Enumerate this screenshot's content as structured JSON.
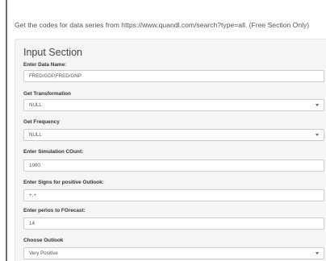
{
  "intro": {
    "text": "Get the codes for data series from https://www.quandl.com/search?type=all. (Free Section Only)"
  },
  "panel": {
    "title": "Input Section",
    "fields": [
      {
        "label": "Enter Data Name:",
        "type": "text",
        "value": "FRED/GDP,FRED/GNP"
      },
      {
        "label": "Get Transformation",
        "type": "select",
        "value": "NULL"
      },
      {
        "label": "Get Frequency",
        "type": "select",
        "value": "NULL"
      },
      {
        "label": "Enter Simulation COunt:",
        "type": "text",
        "value": "1000"
      },
      {
        "label": "Enter Signs for positive Outlook:",
        "type": "text",
        "value": "+,+"
      },
      {
        "label": "Enter perios to FOrecast:",
        "type": "text",
        "value": "14"
      },
      {
        "label": "Choose Outlook",
        "type": "select",
        "value": "Very Positive"
      }
    ]
  },
  "icons": {
    "dropdown": "chevron-down-icon"
  }
}
